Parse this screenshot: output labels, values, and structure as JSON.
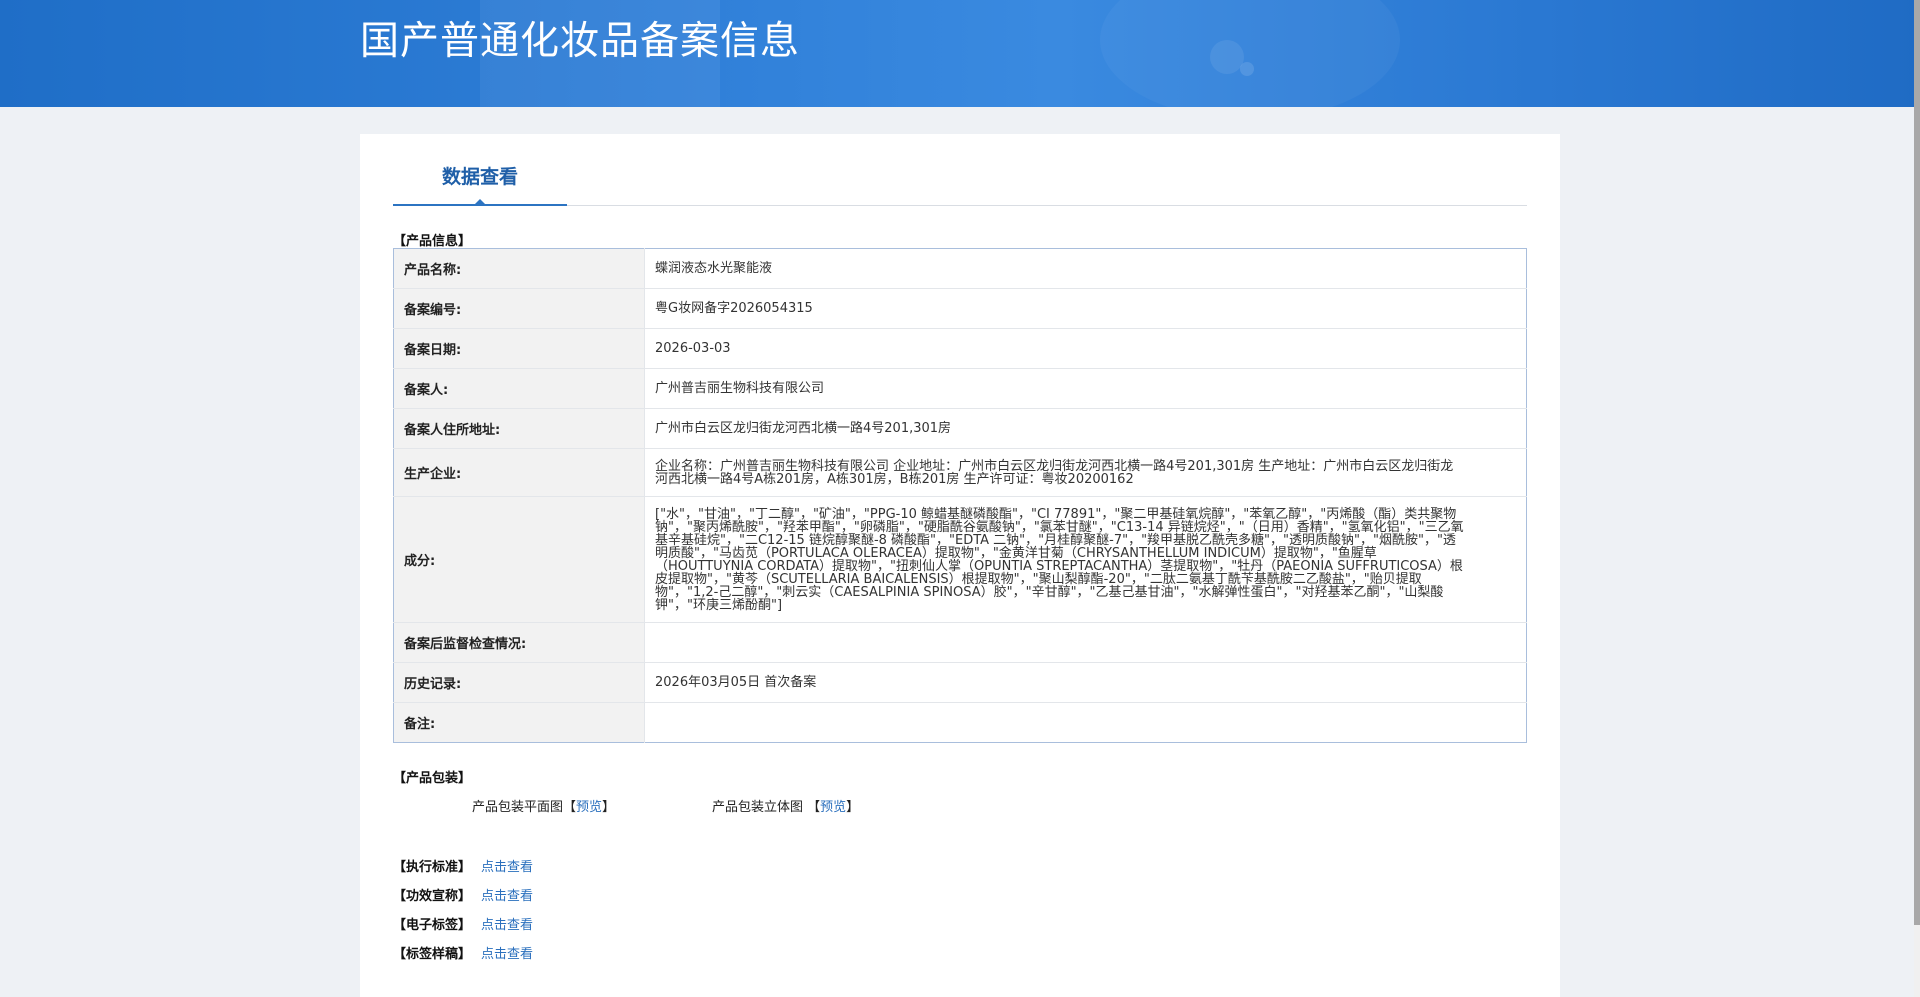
{
  "header": {
    "title": "国产普通化妆品备案信息"
  },
  "tabs": [
    {
      "label": "数据查看"
    }
  ],
  "product_section": {
    "label": "【产品信息】",
    "rows": [
      {
        "label": "产品名称:",
        "value": "蝶润液态水光聚能液"
      },
      {
        "label": "备案编号:",
        "value": "粤G妆网备字2026054315"
      },
      {
        "label": "备案日期:",
        "value": "2026-03-03"
      },
      {
        "label": "备案人:",
        "value": "广州普吉丽生物科技有限公司"
      },
      {
        "label": "备案人住所地址:",
        "value": "广州市白云区龙归街龙河西北横一路4号201,301房"
      },
      {
        "label": "生产企业:",
        "value": "企业名称：广州普吉丽生物科技有限公司 企业地址：广州市白云区龙归街龙河西北横一路4号201,301房 生产地址：广州市白云区龙归街龙河西北横一路4号A栋201房，A栋301房，B栋201房 生产许可证：粤妆20200162"
      },
      {
        "label": "成分:",
        "value": "[\"水\"，\"甘油\"，\"丁二醇\"，\"矿油\"，\"PPG-10 鲸蜡基醚磷酸酯\"，\"CI 77891\"，\"聚二甲基硅氧烷醇\"，\"苯氧乙醇\"，\"丙烯酸（酯）类共聚物钠\"，\"聚丙烯酰胺\"，\"羟苯甲酯\"，\"卵磷脂\"，\"硬脂酰谷氨酸钠\"，\"氯苯甘醚\"，\"C13-14 异链烷烃\"，\"（日用）香精\"，\"氢氧化铝\"，\"三乙氧基辛基硅烷\"，\"二C12-15 链烷醇聚醚-8 磷酸酯\"，\"EDTA 二钠\"，\"月桂醇聚醚-7\"，\"羧甲基脱乙酰壳多糖\"，\"透明质酸钠\"，\"烟酰胺\"，\"透明质酸\"，\"马齿苋（PORTULACA OLERACEA）提取物\"，\"金黄洋甘菊（CHRYSANTHELLUM INDICUM）提取物\"，\"鱼腥草（HOUTTUYNIA CORDATA）提取物\"，\"扭刺仙人掌（OPUNTIA STREPTACANTHA）茎提取物\"，\"牡丹（PAEONIA SUFFRUTICOSA）根皮提取物\"，\"黄芩（SCUTELLARIA BAICALENSIS）根提取物\"，\"聚山梨醇酯-20\"，\"二肽二氨基丁酰苄基酰胺二乙酸盐\"，\"贻贝提取物\"，\"1,2-己二醇\"，\"刺云实（CAESALPINIA SPINOSA）胶\"，\"辛甘醇\"，\"乙基己基甘油\"，\"水解弹性蛋白\"，\"对羟基苯乙酮\"，\"山梨酸钾\"，\"环庚三烯酚酮\"]"
      },
      {
        "label": "备案后监督检查情况:",
        "value": ""
      },
      {
        "label": "历史记录:",
        "value": "2026年03月05日 首次备案"
      },
      {
        "label": "备注:",
        "value": ""
      }
    ]
  },
  "packaging_section": {
    "label": "【产品包装】",
    "flat_label": "产品包装平面图",
    "solid_label": "产品包装立体图",
    "preview_link": "预览"
  },
  "extras": [
    {
      "tag": "【执行标准】",
      "link": "点击查看"
    },
    {
      "tag": "【功效宣称】",
      "link": "点击查看"
    },
    {
      "tag": "【电子标签】",
      "link": "点击查看"
    },
    {
      "tag": "【标签样稿】",
      "link": "点击查看"
    }
  ]
}
